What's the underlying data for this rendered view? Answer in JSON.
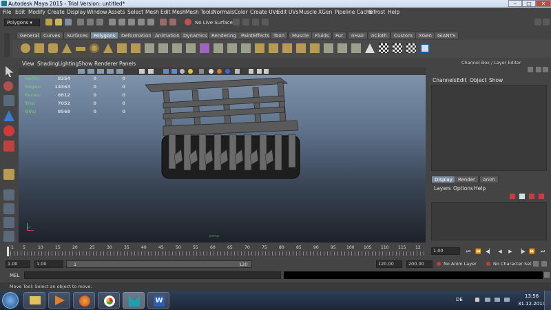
{
  "window": {
    "title": "Autodesk Maya 2015 - Trial Version: untitled*",
    "minimize": "–",
    "maximize": "□",
    "close": "✕"
  },
  "menus": [
    "File",
    "Edit",
    "Modify",
    "Create",
    "Display",
    "Window",
    "Assets",
    "Select",
    "Mesh",
    "Edit Mesh",
    "Mesh Tools",
    "Normals",
    "Color",
    "Create UVs",
    "Edit UVs",
    "Muscle",
    "XGen",
    "Pipeline Cache",
    "Bifrost",
    "Help"
  ],
  "status": {
    "mode": "Polygons",
    "live_surface": "No Live Surface"
  },
  "shelf_tabs": [
    "General",
    "Curves",
    "Surfaces",
    "Polygons",
    "Deformation",
    "Animation",
    "Dynamics",
    "Rendering",
    "PaintEffects",
    "Toon",
    "Muscle",
    "Fluids",
    "Fur",
    "nHair",
    "nCloth",
    "Custom",
    "XGen",
    "GIANTS"
  ],
  "shelf_active": "Polygons",
  "viewport": {
    "menus": [
      "View",
      "Shading",
      "Lighting",
      "Show",
      "Renderer",
      "Panels"
    ],
    "label": "persp",
    "hud": [
      {
        "label": "Verts:",
        "v1": "8354",
        "v2": "0",
        "v3": "0"
      },
      {
        "label": "Edges:",
        "v1": "14363",
        "v2": "0",
        "v3": "0"
      },
      {
        "label": "Faces:",
        "v1": "6812",
        "v2": "0",
        "v3": "0"
      },
      {
        "label": "Tris:",
        "v1": "7052",
        "v2": "0",
        "v3": "0"
      },
      {
        "label": "UVs:",
        "v1": "8568",
        "v2": "0",
        "v3": "0"
      }
    ]
  },
  "channel_box": {
    "title": "Channel Box / Layer Editor",
    "menus": [
      "Channels",
      "Edit",
      "Object",
      "Show"
    ],
    "layer_tabs": [
      "Display",
      "Render",
      "Anim"
    ],
    "layer_menus": [
      "Layers",
      "Options",
      "Help"
    ]
  },
  "time": {
    "ticks": [
      "1",
      "5",
      "10",
      "15",
      "20",
      "25",
      "30",
      "35",
      "40",
      "45",
      "50",
      "55",
      "60",
      "65",
      "70",
      "75",
      "80",
      "85",
      "90",
      "95",
      "100",
      "105",
      "110",
      "115",
      "12"
    ],
    "current": "1.00"
  },
  "range": {
    "start_outer": "1.00",
    "start_inner": "1.00",
    "slider_start": "1",
    "slider_end": "120",
    "end_inner": "120.00",
    "end_outer": "200.00",
    "anim_layer": "No Anim Layer",
    "char_set": "No Character Set"
  },
  "command": {
    "label": "MEL"
  },
  "help": "Move Tool: Select an object to move.",
  "taskbar": {
    "lang": "DE",
    "time": "13:56",
    "date": "31.12.2014"
  },
  "colors": {
    "accent": "#7a8ea0",
    "hud_green": "#6fc36f"
  }
}
